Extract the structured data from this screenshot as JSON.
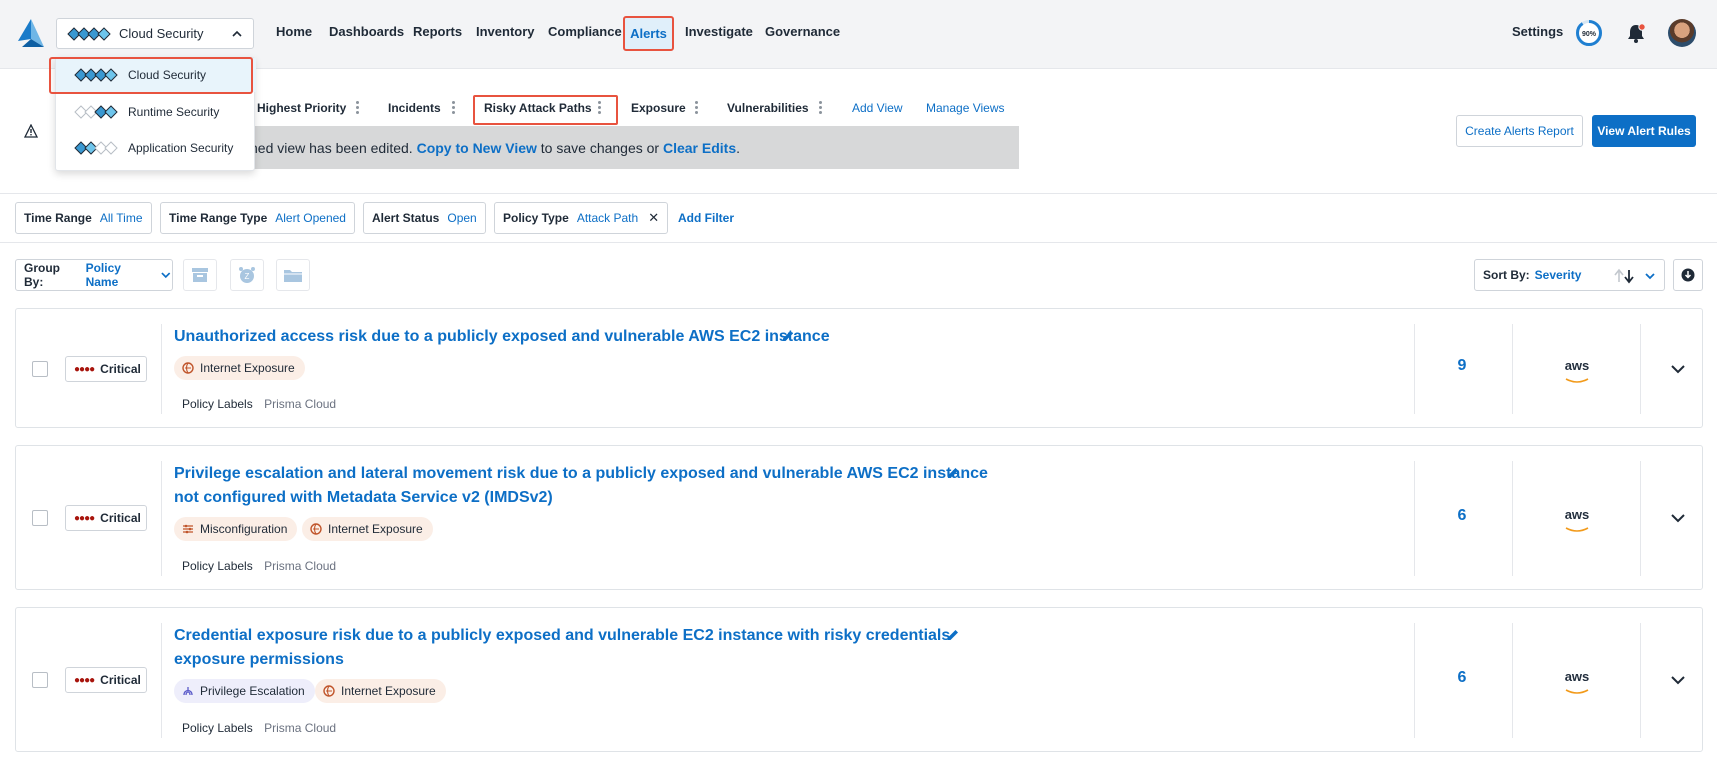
{
  "topnav": {
    "product": "Cloud Security",
    "items": [
      "Home",
      "Dashboards",
      "Reports",
      "Inventory",
      "Compliance",
      "Alerts",
      "Investigate",
      "Governance"
    ],
    "settings": "Settings",
    "progress": "90%"
  },
  "product_menu": {
    "items": [
      "Cloud Security",
      "Runtime Security",
      "Application Security"
    ]
  },
  "views": {
    "tabs": [
      "Highest Priority",
      "Incidents",
      "Risky Attack Paths",
      "Exposure",
      "Vulnerabilities"
    ],
    "add_view": "Add View",
    "manage_views": "Manage Views",
    "banner_prefix": "ned view has been edited.",
    "banner_copy": "Copy to New View",
    "banner_mid": "to save changes or",
    "banner_clear": "Clear Edits",
    "banner_end": "."
  },
  "actions": {
    "create_report": "Create Alerts Report",
    "view_rules": "View Alert Rules"
  },
  "filters": [
    {
      "key": "Time Range",
      "value": "All Time"
    },
    {
      "key": "Time Range Type",
      "value": "Alert Opened"
    },
    {
      "key": "Alert Status",
      "value": "Open"
    },
    {
      "key": "Policy Type",
      "value": "Attack Path"
    }
  ],
  "add_filter": "Add Filter",
  "group_by": {
    "label": "Group By:",
    "value": "Policy Name"
  },
  "sort_by": {
    "label": "Sort By:",
    "value": "Severity"
  },
  "alerts": [
    {
      "severity": "Critical",
      "title": "Unauthorized access risk due to a publicly exposed and vulnerable AWS EC2 instance",
      "title2": "",
      "chips": [
        "Internet Exposure"
      ],
      "policy_labels_key": "Policy Labels",
      "policy_labels_value": "Prisma Cloud",
      "count": "9",
      "cloud": "aws"
    },
    {
      "severity": "Critical",
      "title": "Privilege escalation and lateral movement risk due to a publicly exposed and vulnerable AWS EC2 instance",
      "title2": "not configured with Metadata Service v2 (IMDSv2)",
      "chips": [
        "Misconfiguration",
        "Internet Exposure"
      ],
      "policy_labels_key": "Policy Labels",
      "policy_labels_value": "Prisma Cloud",
      "count": "6",
      "cloud": "aws"
    },
    {
      "severity": "Critical",
      "title": "Credential exposure risk due to a publicly exposed and vulnerable EC2 instance with risky credentials",
      "title2": "exposure permissions",
      "chips": [
        "Privilege Escalation",
        "Internet Exposure"
      ],
      "policy_labels_key": "Policy Labels",
      "policy_labels_value": "Prisma Cloud",
      "count": "6",
      "cloud": "aws"
    }
  ],
  "colors": {
    "accent": "#0d6fc6",
    "highlight": "#e8533f",
    "critical": "#a8150d"
  }
}
